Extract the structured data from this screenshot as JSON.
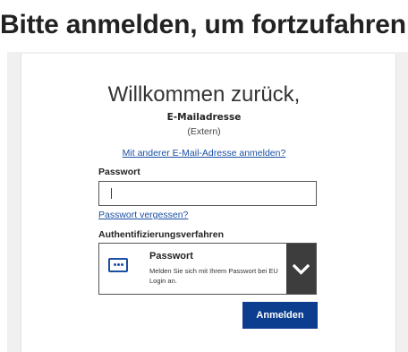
{
  "page": {
    "heading": "Bitte anmelden, um fortzufahren"
  },
  "login": {
    "welcome": "Willkommen zurück,",
    "email": "E-Mailadresse",
    "account_type": "(Extern)",
    "other_email_link": "Mit anderer E-Mail-Adresse anmelden?",
    "password_label": "Passwort",
    "password_value": "",
    "forgot_link": "Passwort vergessen?",
    "auth_label": "Authentifizierungsverfahren",
    "auth_method": {
      "title": "Passwort",
      "description": "Melden Sie sich mit Ihrem Passwort bei EU Login an.",
      "icon": "password-dots-icon"
    },
    "submit_label": "Anmelden"
  },
  "colors": {
    "accent": "#0d3d8f",
    "link": "#1a4fa3",
    "dropdown_toggle": "#3d3d3d",
    "backdrop": "#f0f0f0"
  }
}
